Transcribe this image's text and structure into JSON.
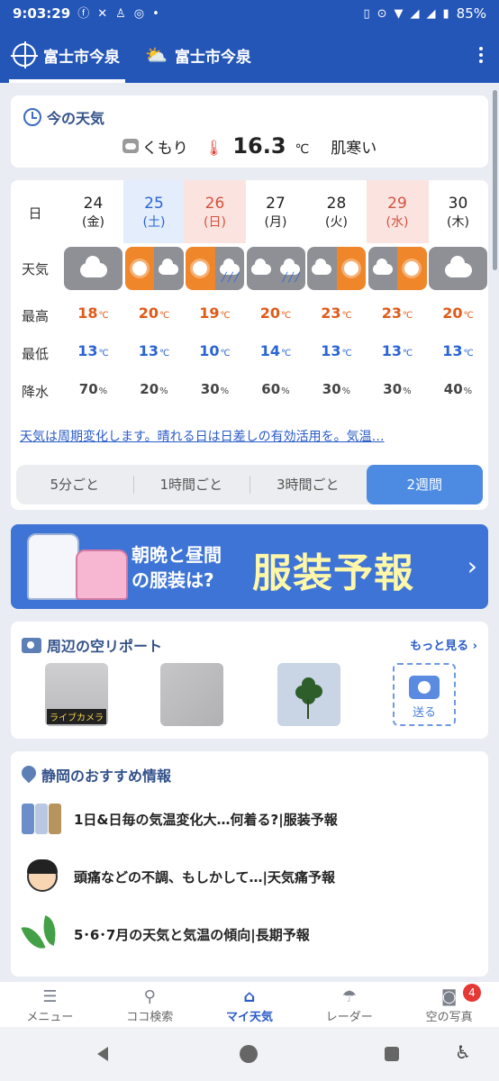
{
  "status": {
    "time": "9:03:29",
    "battery": "85%"
  },
  "tabs": [
    {
      "label": "富士市今泉"
    },
    {
      "label": "富士市今泉"
    }
  ],
  "now": {
    "title": "今の天気",
    "condition": "くもり",
    "temp": "16.3",
    "unit": "℃",
    "feel": "肌寒い"
  },
  "forecast": {
    "labels": {
      "day": "日",
      "weather": "天気",
      "high": "最高",
      "low": "最低",
      "rain": "降水"
    },
    "temp_unit": "℃",
    "pct_unit": "%",
    "days": [
      {
        "date": "24",
        "weekday": "(金)",
        "high": "18",
        "low": "13",
        "rain": "70",
        "icon": "cloudy"
      },
      {
        "date": "25",
        "weekday": "(土)",
        "high": "20",
        "low": "13",
        "rain": "20",
        "icon": "sun-then-cloud"
      },
      {
        "date": "26",
        "weekday": "(日)",
        "high": "19",
        "low": "10",
        "rain": "30",
        "icon": "sun-then-rain"
      },
      {
        "date": "27",
        "weekday": "(月)",
        "high": "20",
        "low": "14",
        "rain": "60",
        "icon": "cloud-then-rain"
      },
      {
        "date": "28",
        "weekday": "(火)",
        "high": "23",
        "low": "13",
        "rain": "30",
        "icon": "cloud-then-sun"
      },
      {
        "date": "29",
        "weekday": "(水)",
        "high": "23",
        "low": "13",
        "rain": "30",
        "icon": "cloud-then-sun"
      },
      {
        "date": "30",
        "weekday": "(木)",
        "high": "20",
        "low": "13",
        "rain": "40",
        "icon": "cloudy"
      }
    ],
    "note": "天気は周期変化します。晴れる日は日差しの有効活用を。気温…",
    "tabs": [
      "5分ごと",
      "1時間ごと",
      "3時間ごと",
      "2週間"
    ]
  },
  "banner": {
    "line1": "朝晩と昼間",
    "line2": "の服装は?",
    "big": "服装予報"
  },
  "sky_report": {
    "title": "周辺の空リポート",
    "more": "もっと見る ›",
    "live_badge": "ライブカメラ",
    "send": "送る"
  },
  "recommend": {
    "title": "静岡のおすすめ情報",
    "items": [
      {
        "text": "1日&日毎の気温変化大…何着る?|服装予報"
      },
      {
        "text": "頭痛などの不調、もしかして…|天気痛予報"
      },
      {
        "text": "5･6･7月の天気と気温の傾向|長期予報"
      }
    ]
  },
  "nav": {
    "items": [
      {
        "label": "メニュー",
        "icon": "menu-icon"
      },
      {
        "label": "ココ検索",
        "icon": "search-icon"
      },
      {
        "label": "マイ天気",
        "icon": "home-icon"
      },
      {
        "label": "レーダー",
        "icon": "radar-icon"
      },
      {
        "label": "空の写真",
        "icon": "camera-icon"
      }
    ],
    "badge": "4"
  },
  "colors": {
    "brand": "#2456b8",
    "high": "#e05a18",
    "low": "#2a64d4",
    "sat_bg": "#e3edfb",
    "sun_bg": "#fbe4e0"
  }
}
